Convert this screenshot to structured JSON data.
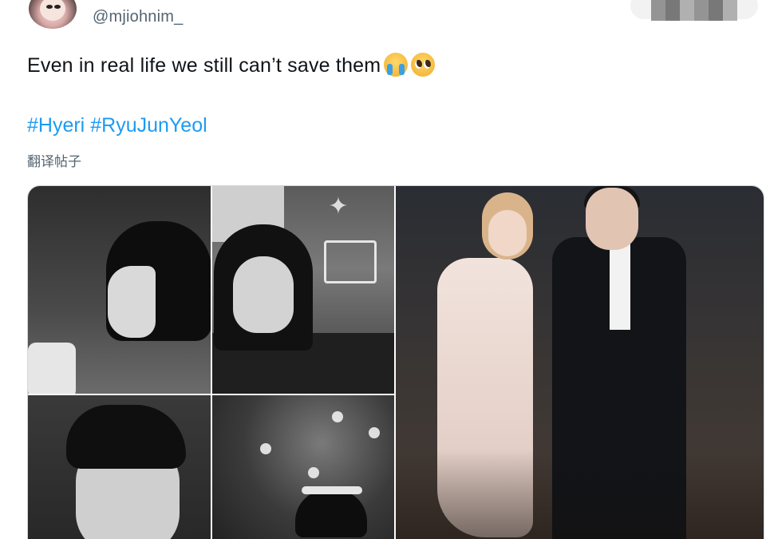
{
  "tweet": {
    "handle": "@mjiohnim_",
    "text": "Even in real life we still can’t save them",
    "emojis": [
      "loudly-crying-face",
      "pleading-face"
    ],
    "hashtags": [
      "#Hyeri",
      "#RyuJunYeol"
    ],
    "translate_label": "翻译帖子"
  },
  "colors": {
    "handle": "#536471",
    "hashtag": "#1d9bf0",
    "text": "#0f1419"
  },
  "media": {
    "panels": [
      {
        "name": "grayscale-still-1",
        "style": "black-and-white"
      },
      {
        "name": "grayscale-still-2",
        "style": "black-and-white"
      },
      {
        "name": "grayscale-still-3",
        "style": "black-and-white"
      },
      {
        "name": "grayscale-still-4",
        "style": "black-and-white"
      },
      {
        "name": "color-photo-couple",
        "style": "color"
      }
    ]
  }
}
